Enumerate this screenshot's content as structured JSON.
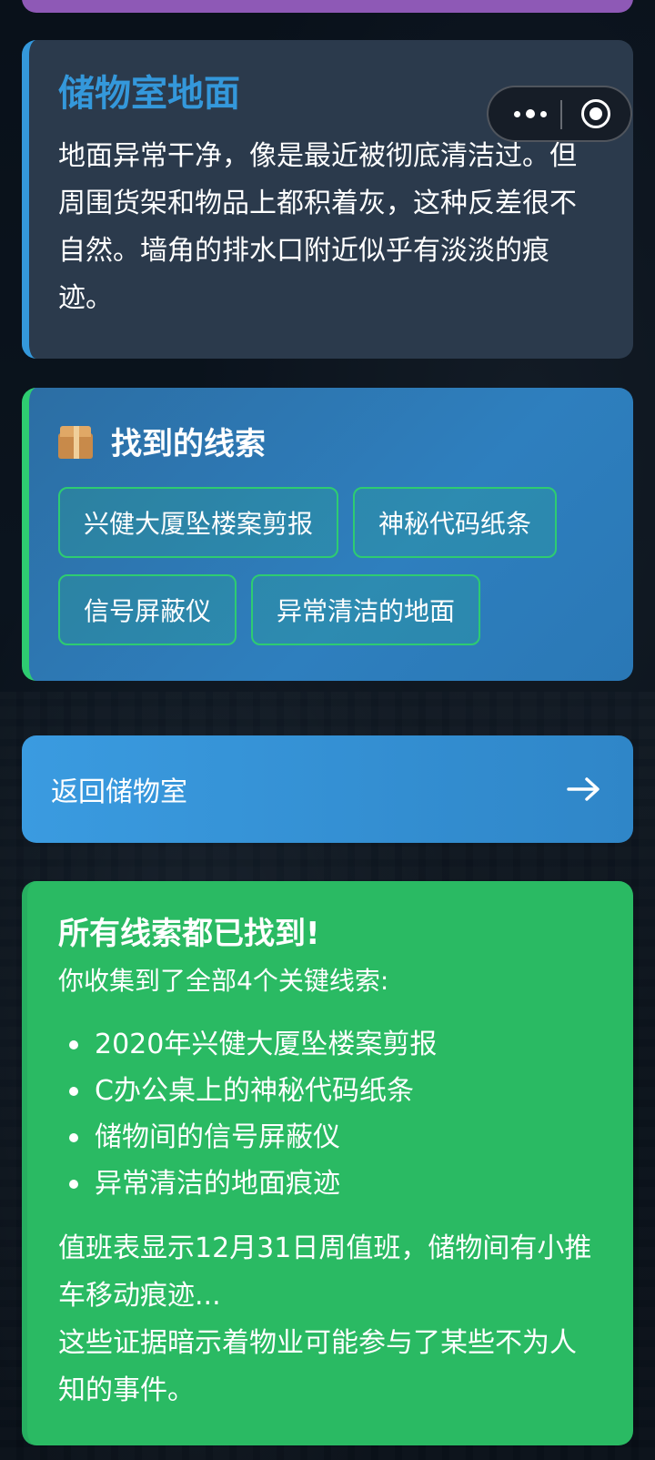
{
  "location": {
    "title": "储物室地面",
    "description": "地面异常干净，像是最近被彻底清洁过。但周围货架和物品上都积着灰，这种反差很不自然。墙角的排水口附近似乎有淡淡的痕迹。"
  },
  "capsule": {
    "more_icon": "more-dots-icon",
    "close_icon": "target-circle-icon"
  },
  "clues": {
    "icon": "package-icon",
    "title": "找到的线索",
    "items": [
      "兴健大厦坠楼案剪报",
      "神秘代码纸条",
      "信号屏蔽仪",
      "异常清洁的地面"
    ]
  },
  "back_button": {
    "label": "返回储物室",
    "icon": "arrow-right-icon"
  },
  "completion": {
    "title": "所有线索都已找到!",
    "subtitle": "你收集到了全部4个关键线索:",
    "list": [
      "2020年兴健大厦坠楼案剪报",
      "C办公桌上的神秘代码纸条",
      "储物间的信号屏蔽仪",
      "异常清洁的地面痕迹"
    ],
    "note_line1": "值班表显示12月31日周值班，储物间有小推车移动痕迹...",
    "note_line2": "这些证据暗示着物业可能参与了某些不为人知的事件。"
  },
  "colors": {
    "location_accent": "#3498db",
    "clue_accent": "#2ecc71",
    "completion_bg": "#2aba63",
    "top_card": "#8e59b6"
  }
}
